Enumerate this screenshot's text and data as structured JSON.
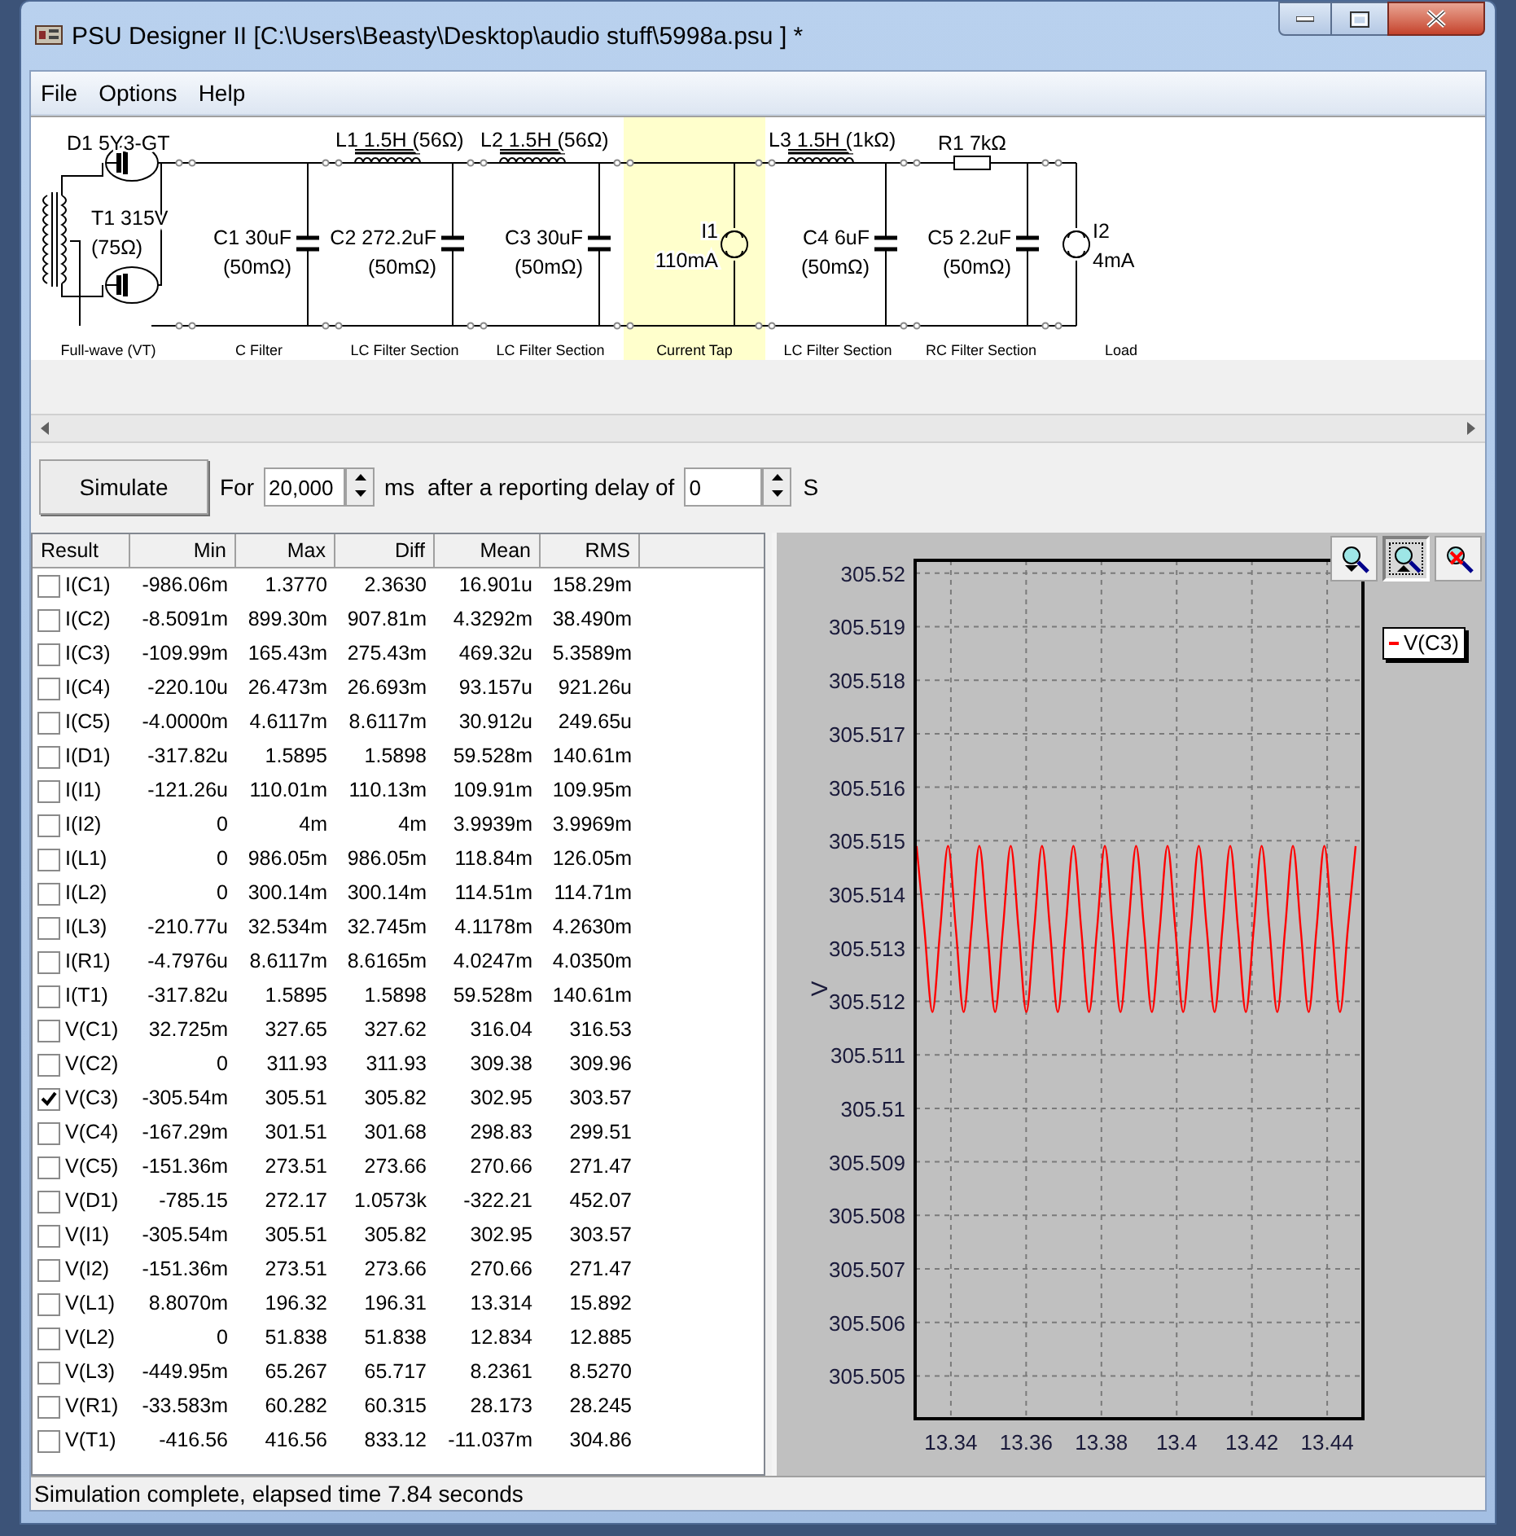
{
  "window": {
    "title": "PSU Designer II  [C:\\Users\\Beasty\\Desktop\\audio stuff\\5998a.psu ] *"
  },
  "menu": [
    "File",
    "Options",
    "Help"
  ],
  "schematic": {
    "sections": [
      {
        "label": "Full-wave (VT)",
        "selected": false,
        "components": [
          {
            "kind": "diode",
            "lines": [
              "D1 5Y3-GT"
            ]
          },
          {
            "kind": "transformer",
            "lines": [
              "T1 315V",
              "(75Ω)"
            ]
          }
        ]
      },
      {
        "label": "C Filter",
        "selected": false,
        "components": [
          {
            "kind": "capacitor",
            "lines": [
              "C1 30uF",
              "(50mΩ)"
            ]
          }
        ]
      },
      {
        "label": "LC Filter Section",
        "selected": false,
        "components": [
          {
            "kind": "inductor",
            "lines": [
              "L1 1.5H (56Ω)"
            ]
          },
          {
            "kind": "capacitor",
            "lines": [
              "C2 272.2uF",
              "(50mΩ)"
            ]
          }
        ]
      },
      {
        "label": "LC Filter Section",
        "selected": false,
        "components": [
          {
            "kind": "inductor",
            "lines": [
              "L2 1.5H (56Ω)"
            ]
          },
          {
            "kind": "capacitor",
            "lines": [
              "C3 30uF",
              "(50mΩ)"
            ]
          }
        ]
      },
      {
        "label": "Current Tap",
        "selected": true,
        "components": [
          {
            "kind": "current_source",
            "lines": [
              "I1",
              "110mA"
            ]
          }
        ]
      },
      {
        "label": "LC Filter Section",
        "selected": false,
        "components": [
          {
            "kind": "inductor",
            "lines": [
              "L3 1.5H (1kΩ)"
            ]
          },
          {
            "kind": "capacitor",
            "lines": [
              "C4 6uF",
              "(50mΩ)"
            ]
          }
        ]
      },
      {
        "label": "RC Filter Section",
        "selected": false,
        "components": [
          {
            "kind": "resistor",
            "lines": [
              "R1 7kΩ"
            ]
          },
          {
            "kind": "capacitor",
            "lines": [
              "C5 2.2uF",
              "(50mΩ)"
            ]
          }
        ]
      },
      {
        "label": "Load",
        "selected": false,
        "components": [
          {
            "kind": "load",
            "lines": [
              "I2",
              "4mA"
            ]
          }
        ]
      }
    ]
  },
  "toolbar": {
    "simulate": "Simulate",
    "for_label": "For",
    "duration": "20,000",
    "delay_label": "ms  after a reporting delay of",
    "delay": "0",
    "unit": "S"
  },
  "results": {
    "columns": [
      "Result",
      "Min",
      "Max",
      "Diff",
      "Mean",
      "RMS"
    ],
    "rows": [
      {
        "label": "I(C1)",
        "checked": false,
        "values": [
          "-986.06m",
          "1.3770",
          "2.3630",
          "16.901u",
          "158.29m"
        ]
      },
      {
        "label": "I(C2)",
        "checked": false,
        "values": [
          "-8.5091m",
          "899.30m",
          "907.81m",
          "4.3292m",
          "38.490m"
        ]
      },
      {
        "label": "I(C3)",
        "checked": false,
        "values": [
          "-109.99m",
          "165.43m",
          "275.43m",
          "469.32u",
          "5.3589m"
        ]
      },
      {
        "label": "I(C4)",
        "checked": false,
        "values": [
          "-220.10u",
          "26.473m",
          "26.693m",
          "93.157u",
          "921.26u"
        ]
      },
      {
        "label": "I(C5)",
        "checked": false,
        "values": [
          "-4.0000m",
          "4.6117m",
          "8.6117m",
          "30.912u",
          "249.65u"
        ]
      },
      {
        "label": "I(D1)",
        "checked": false,
        "values": [
          "-317.82u",
          "1.5895",
          "1.5898",
          "59.528m",
          "140.61m"
        ]
      },
      {
        "label": "I(I1)",
        "checked": false,
        "values": [
          "-121.26u",
          "110.01m",
          "110.13m",
          "109.91m",
          "109.95m"
        ]
      },
      {
        "label": "I(I2)",
        "checked": false,
        "values": [
          "0",
          "4m",
          "4m",
          "3.9939m",
          "3.9969m"
        ]
      },
      {
        "label": "I(L1)",
        "checked": false,
        "values": [
          "0",
          "986.05m",
          "986.05m",
          "118.84m",
          "126.05m"
        ]
      },
      {
        "label": "I(L2)",
        "checked": false,
        "values": [
          "0",
          "300.14m",
          "300.14m",
          "114.51m",
          "114.71m"
        ]
      },
      {
        "label": "I(L3)",
        "checked": false,
        "values": [
          "-210.77u",
          "32.534m",
          "32.745m",
          "4.1178m",
          "4.2630m"
        ]
      },
      {
        "label": "I(R1)",
        "checked": false,
        "values": [
          "-4.7976u",
          "8.6117m",
          "8.6165m",
          "4.0247m",
          "4.0350m"
        ]
      },
      {
        "label": "I(T1)",
        "checked": false,
        "values": [
          "-317.82u",
          "1.5895",
          "1.5898",
          "59.528m",
          "140.61m"
        ]
      },
      {
        "label": "V(C1)",
        "checked": false,
        "values": [
          "32.725m",
          "327.65",
          "327.62",
          "316.04",
          "316.53"
        ]
      },
      {
        "label": "V(C2)",
        "checked": false,
        "values": [
          "0",
          "311.93",
          "311.93",
          "309.38",
          "309.96"
        ]
      },
      {
        "label": "V(C3)",
        "checked": true,
        "values": [
          "-305.54m",
          "305.51",
          "305.82",
          "302.95",
          "303.57"
        ]
      },
      {
        "label": "V(C4)",
        "checked": false,
        "values": [
          "-167.29m",
          "301.51",
          "301.68",
          "298.83",
          "299.51"
        ]
      },
      {
        "label": "V(C5)",
        "checked": false,
        "values": [
          "-151.36m",
          "273.51",
          "273.66",
          "270.66",
          "271.47"
        ]
      },
      {
        "label": "V(D1)",
        "checked": false,
        "values": [
          "-785.15",
          "272.17",
          "1.0573k",
          "-322.21",
          "452.07"
        ]
      },
      {
        "label": "V(I1)",
        "checked": false,
        "values": [
          "-305.54m",
          "305.51",
          "305.82",
          "302.95",
          "303.57"
        ]
      },
      {
        "label": "V(I2)",
        "checked": false,
        "values": [
          "-151.36m",
          "273.51",
          "273.66",
          "270.66",
          "271.47"
        ]
      },
      {
        "label": "V(L1)",
        "checked": false,
        "values": [
          "8.8070m",
          "196.32",
          "196.31",
          "13.314",
          "15.892"
        ]
      },
      {
        "label": "V(L2)",
        "checked": false,
        "values": [
          "0",
          "51.838",
          "51.838",
          "12.834",
          "12.885"
        ]
      },
      {
        "label": "V(L3)",
        "checked": false,
        "values": [
          "-449.95m",
          "65.267",
          "65.717",
          "8.2361",
          "8.5270"
        ]
      },
      {
        "label": "V(R1)",
        "checked": false,
        "values": [
          "-33.583m",
          "60.282",
          "60.315",
          "28.173",
          "28.245"
        ]
      },
      {
        "label": "V(T1)",
        "checked": false,
        "values": [
          "-416.56",
          "416.56",
          "833.12",
          "-11.037m",
          "304.86"
        ]
      }
    ]
  },
  "plot": {
    "tools": [
      {
        "kind": "zoom_in",
        "selected": false
      },
      {
        "kind": "zoom_out",
        "selected": true
      },
      {
        "kind": "zoom_reset",
        "selected": false
      }
    ],
    "chart_data": {
      "type": "line",
      "grid": true,
      "ylabel": "V",
      "xlim": [
        13.3305,
        13.4495
      ],
      "ylim": [
        305.5042,
        305.52024
      ],
      "xticks": [
        13.34,
        13.36,
        13.38,
        {
          "value": 13.4,
          "label": "13.4"
        },
        13.42,
        13.44
      ],
      "yticks": [
        {
          "value": 305.505,
          "label": "305.505"
        },
        {
          "value": 305.506,
          "label": "305.506"
        },
        {
          "value": 305.507,
          "label": "305.507"
        },
        {
          "value": 305.508,
          "label": "305.508"
        },
        {
          "value": 305.509,
          "label": "305.509"
        },
        {
          "value": 305.51,
          "label": "305.51"
        },
        {
          "value": 305.511,
          "label": "305.511"
        },
        {
          "value": 305.512,
          "label": "305.512"
        },
        {
          "value": 305.513,
          "label": "305.513"
        },
        {
          "value": 305.514,
          "label": "305.514"
        },
        {
          "value": 305.515,
          "label": "305.515"
        },
        {
          "value": 305.516,
          "label": "305.516"
        },
        {
          "value": 305.517,
          "label": "305.517"
        },
        {
          "value": 305.518,
          "label": "305.518"
        },
        {
          "value": 305.519,
          "label": "305.519"
        },
        {
          "value": 305.52,
          "label": "305.52"
        }
      ],
      "x": [
        13.3309,
        13.33298,
        13.33507,
        13.33715,
        13.33923,
        13.34132,
        13.3434,
        13.34548,
        13.34757,
        13.34965,
        13.35173,
        13.35382,
        13.3559,
        13.35798,
        13.36007,
        13.36215,
        13.36423,
        13.36632,
        13.3684,
        13.37048,
        13.37257,
        13.37465,
        13.37673,
        13.37882,
        13.3809,
        13.38298,
        13.38507,
        13.38715,
        13.38923,
        13.39132,
        13.3934,
        13.39548,
        13.39757,
        13.39965,
        13.40173,
        13.40382,
        13.4059,
        13.40798,
        13.41007,
        13.41215,
        13.41423,
        13.41632,
        13.4184,
        13.42048,
        13.42257,
        13.42465,
        13.42673,
        13.42882,
        13.4309,
        13.43298,
        13.43507,
        13.43715,
        13.43923,
        13.44132,
        13.4434,
        13.44548,
        13.44757
      ],
      "series": [
        {
          "name": "V(C3)",
          "color": "#ff0000",
          "values": [
            305.5149,
            305.51335,
            305.5118,
            305.51335,
            305.5149,
            305.51335,
            305.5118,
            305.51335,
            305.5149,
            305.51335,
            305.5118,
            305.51335,
            305.5149,
            305.51335,
            305.5118,
            305.51335,
            305.5149,
            305.51335,
            305.5118,
            305.51335,
            305.5149,
            305.51335,
            305.5118,
            305.51335,
            305.5149,
            305.51335,
            305.5118,
            305.51335,
            305.5149,
            305.51335,
            305.5118,
            305.51335,
            305.5149,
            305.51335,
            305.5118,
            305.51335,
            305.5149,
            305.51335,
            305.5118,
            305.51335,
            305.5149,
            305.51335,
            305.5118,
            305.51335,
            305.5149,
            305.51335,
            305.5118,
            305.51335,
            305.5149,
            305.51335,
            305.5118,
            305.51335,
            305.5149,
            305.51335,
            305.5118,
            305.51335,
            305.5149
          ]
        }
      ]
    }
  },
  "status_bar": "Simulation complete, elapsed time 7.84 seconds"
}
